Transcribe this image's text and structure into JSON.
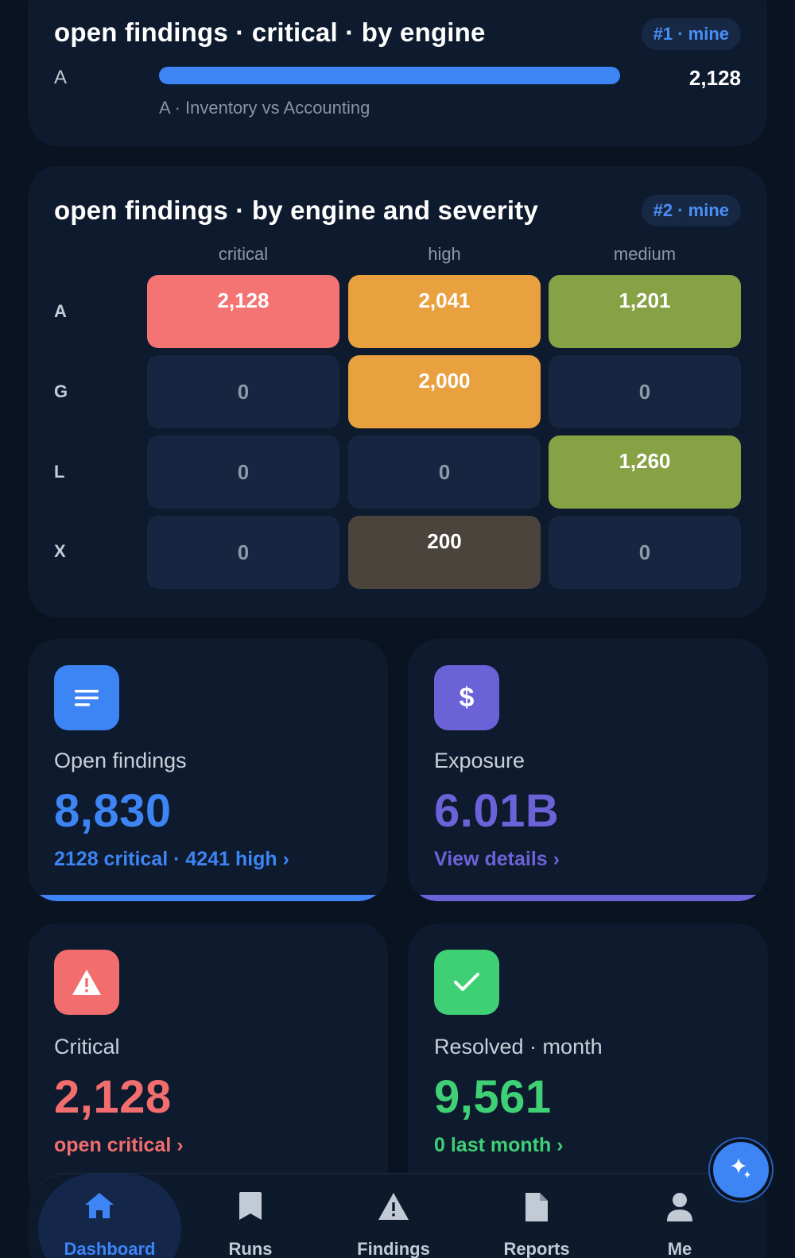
{
  "critical_by_engine": {
    "title": "open findings · critical · by engine",
    "badge": "#1 · mine",
    "rows": [
      {
        "label": "A",
        "value": "2,128",
        "fill_fraction": 1.0,
        "sublabel": "A · Inventory vs Accounting"
      }
    ],
    "bar_color": "#3d84f5"
  },
  "engine_severity": {
    "title": "open findings · by engine and severity",
    "badge": "#2 · mine",
    "columns": [
      "critical",
      "high",
      "medium"
    ],
    "rows": [
      {
        "label": "A",
        "cells": [
          "2,128",
          "2,041",
          "1,201"
        ]
      },
      {
        "label": "G",
        "cells": [
          "0",
          "2,000",
          "0"
        ]
      },
      {
        "label": "L",
        "cells": [
          "0",
          "0",
          "1,260"
        ]
      },
      {
        "label": "X",
        "cells": [
          "0",
          "200",
          "0"
        ]
      }
    ],
    "colors": {
      "critical": "#f47373",
      "high": "#e9a03f",
      "medium": "#87a245",
      "low_high": "#4a443d",
      "empty": "#172640"
    }
  },
  "tiles": {
    "open_findings": {
      "label": "Open findings",
      "value": "8,830",
      "link": "2128 critical · 4241 high ›",
      "color": "#3d84f5",
      "icon": "list-icon"
    },
    "exposure": {
      "label": "Exposure",
      "value": "6.01B",
      "link": "View details ›",
      "color": "#6c62d8",
      "icon": "dollar-icon"
    },
    "critical": {
      "label": "Critical",
      "value": "2,128",
      "link": "open critical ›",
      "color": "#f26d6d",
      "icon": "warning-icon"
    },
    "resolved": {
      "label": "Resolved · month",
      "value": "9,561",
      "link": "0 last month ›",
      "color": "#3fcf74",
      "icon": "check-icon"
    }
  },
  "nav": {
    "items": [
      {
        "label": "Dashboard",
        "icon": "home-icon",
        "active": true
      },
      {
        "label": "Runs",
        "icon": "bookmark-icon",
        "active": false
      },
      {
        "label": "Findings",
        "icon": "warning-icon",
        "active": false
      },
      {
        "label": "Reports",
        "icon": "document-icon",
        "active": false
      },
      {
        "label": "Me",
        "icon": "person-icon",
        "active": false
      }
    ]
  },
  "fab": {
    "icon": "sparkle-icon"
  }
}
